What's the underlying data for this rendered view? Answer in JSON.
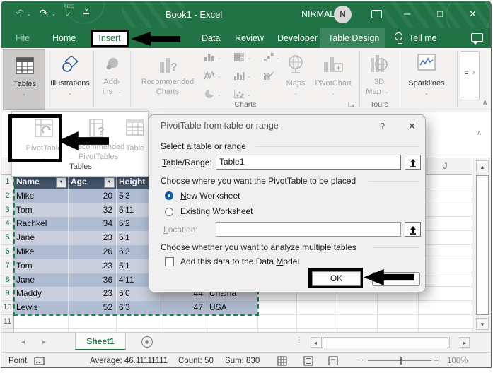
{
  "icons": {
    "undo": "↶",
    "redo": "↷",
    "spell_abc": "ABC",
    "check": "✓",
    "chevron_down": "⌄",
    "chevron_up": "∧",
    "more": "›",
    "dropdown_arrow": "▼",
    "up_arrow": "↑",
    "scroll_left": "◂",
    "scroll_right": "▸",
    "scroll_up": "▲",
    "scroll_down": "▼",
    "minimize": "─",
    "maximize": "□",
    "close": "✕",
    "help": "?",
    "dialog_close": "✕",
    "plus": "+",
    "minus": "−",
    "grip_dots": "⸬",
    "divider_dots": "⋮",
    "question": "?"
  },
  "titlebar": {
    "title": "Book1 - Excel",
    "user_name": "NIRMAL",
    "avatar_initial": "N"
  },
  "menu_tabs": {
    "file": "File",
    "home": "Home",
    "insert": "Insert",
    "data": "Data",
    "review": "Review",
    "developer": "Developer",
    "table_design": "Table Design",
    "tell_me": "Tell me"
  },
  "ribbon": {
    "tables_label": "Tables",
    "illustrations_label": "Illustrations",
    "addins_label_line1": "Add-",
    "addins_label_line2": "ins",
    "recommended_charts_line1": "Recommended",
    "recommended_charts_line2": "Charts",
    "maps_label": "Maps",
    "pivotchart_label": "PivotChart",
    "charts_group_label": "Charts",
    "map3d_label_line1": "3D",
    "map3d_label_line2": "Map",
    "tours_group_label": "Tours",
    "sparklines_label": "Sparklines",
    "cutoff_group_label": "F"
  },
  "tables_flyout": {
    "pivottable_label": "PivotTable",
    "recommended_line1": "Recommended",
    "recommended_line2": "PivotTables",
    "table_label": "Table",
    "group_caption": "Tables"
  },
  "dialog": {
    "title": "PivotTable from table or range",
    "section_select": "Select a table or range",
    "table_range_label": "Table/Range:",
    "table_range_value": "Table1",
    "section_place": "Choose where you want the PivotTable to be placed",
    "option_new": "New Worksheet",
    "option_existing": "Existing Worksheet",
    "location_label": "Location:",
    "location_value": "",
    "section_multiple": "Choose whether you want to analyze multiple tables",
    "checkbox_label": "Add this data to the Data Model",
    "ok_label": "OK"
  },
  "sheet": {
    "visible_column_letter": "J",
    "table": {
      "headers": [
        "Name",
        "Age",
        "Height"
      ],
      "rows": [
        [
          "Mike",
          "20",
          "5'3",
          "",
          ""
        ],
        [
          "Tom",
          "32",
          "5'11",
          "",
          ""
        ],
        [
          "Rachkel",
          "34",
          "5'2",
          "",
          ""
        ],
        [
          "Jane",
          "23",
          "6'1",
          "",
          ""
        ],
        [
          "Mike",
          "26",
          "6'3",
          "",
          ""
        ],
        [
          "Tom",
          "23",
          "5'1",
          "",
          ""
        ],
        [
          "Jane",
          "36",
          "4'11",
          "",
          ""
        ],
        [
          "Maddy",
          "23",
          "5'0",
          "44",
          "Chaina"
        ],
        [
          "Lewis",
          "52",
          "6'3",
          "47",
          "USA"
        ]
      ]
    }
  },
  "sheet_tabs": {
    "active_sheet": "Sheet1"
  },
  "status_bar": {
    "mode": "Point",
    "average": "Average: 46.11111111",
    "count": "Count: 50",
    "sum": "Sum: 830",
    "zoom_level": "100%"
  },
  "colors": {
    "title_green": "#217346",
    "table_header": "#44546A",
    "band_dark": "#AFBCD1",
    "band_light": "#C9CFDC",
    "accent_blue": "#0B5CAB",
    "ants_green": "#0E8A4D"
  }
}
